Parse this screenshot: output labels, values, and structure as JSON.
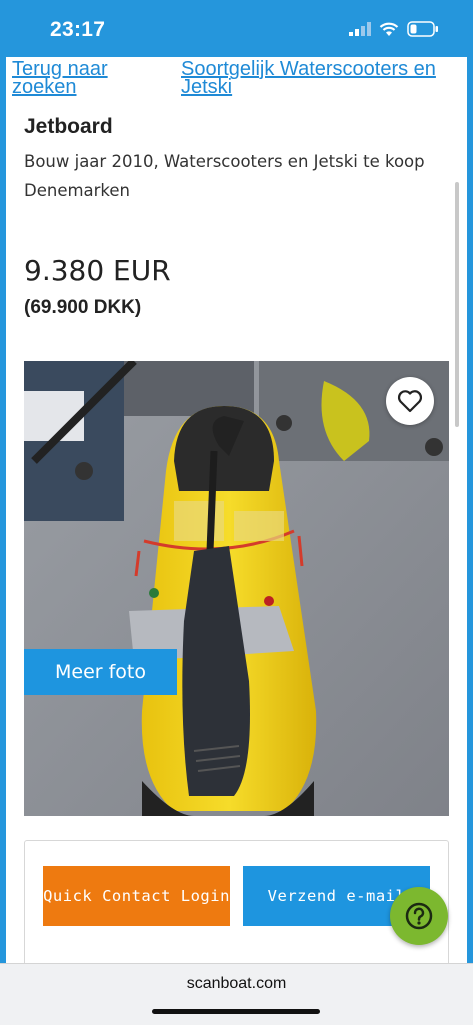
{
  "status_bar": {
    "time": "23:17"
  },
  "nav": {
    "back_link": "Terug naar zoeken",
    "similar_link": "Soortgelijk Waterscooters en Jetski"
  },
  "listing": {
    "title": "Jetboard",
    "subtitle_line1": "Bouw jaar 2010, Waterscooters en Jetski te koop",
    "location": "Denemarken",
    "price_eur": "9.380 EUR",
    "price_dkk": "(69.900 DKK)"
  },
  "photo": {
    "more_photos_label": "Meer foto",
    "favorite_icon": "heart-icon"
  },
  "contact": {
    "quick_contact_label": "Quick Contact Login",
    "send_email_label": "Verzend e-mail"
  },
  "help": {
    "icon": "question-icon"
  },
  "browser": {
    "domain": "scanboat.com"
  },
  "colors": {
    "brand_blue": "#2596dc",
    "link_blue": "#1f8ad6",
    "orange": "#ee7a10",
    "green": "#7cb82f"
  }
}
